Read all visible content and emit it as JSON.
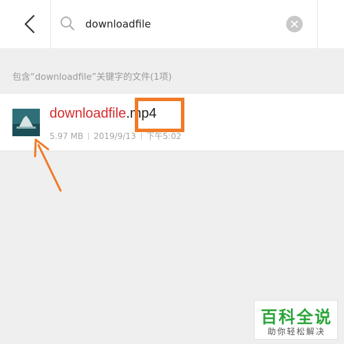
{
  "header": {
    "search_value": "downloadfile",
    "back_icon": "chevron-left-icon",
    "search_icon": "search-icon",
    "clear_icon": "clear-icon"
  },
  "results": {
    "caption": "包含“downloadfile”关键字的文件(1项)",
    "items": [
      {
        "name_highlight": "downloadfile",
        "name_rest": ".mp4",
        "size": "5.97 MB",
        "date": "2019/9/13",
        "time": "下午5:02"
      }
    ]
  },
  "annotation": {
    "color": "#f07a27"
  },
  "watermark": {
    "title": "百科全说",
    "subtitle": "助你轻松解决",
    "color": "#2aa53a"
  }
}
